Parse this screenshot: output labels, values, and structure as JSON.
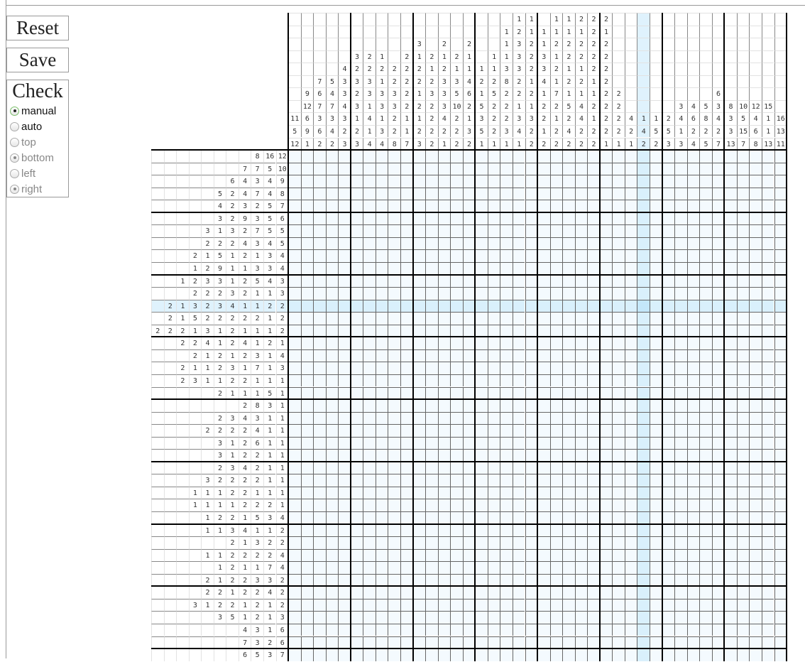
{
  "controls": {
    "reset_label": "Reset",
    "save_label": "Save",
    "check_label": "Check",
    "options": [
      {
        "label": "manual",
        "checked": true,
        "enabled": true
      },
      {
        "label": "auto",
        "checked": false,
        "enabled": true
      },
      {
        "label": "top",
        "checked": false,
        "enabled": false
      },
      {
        "label": "bottom",
        "checked": true,
        "enabled": false
      },
      {
        "label": "left",
        "checked": false,
        "enabled": false
      },
      {
        "label": "right",
        "checked": true,
        "enabled": false
      }
    ]
  },
  "puzzle": {
    "highlight_column": 29,
    "highlight_row": 13,
    "colors": {
      "cell": "#f4fafe",
      "highlight": "#d9f0fc",
      "intersection": "#c4e7fa",
      "grid_line": "#666666",
      "major_line": "#000000"
    },
    "column_clues": [
      [
        11,
        5,
        12
      ],
      [
        9,
        12,
        6,
        9,
        1
      ],
      [
        7,
        6,
        7,
        3,
        6,
        2
      ],
      [
        5,
        4,
        7,
        3,
        4,
        2
      ],
      [
        4,
        3,
        3,
        4,
        3,
        2,
        3
      ],
      [
        3,
        2,
        3,
        2,
        3,
        1,
        2,
        3
      ],
      [
        2,
        2,
        3,
        3,
        1,
        4,
        1,
        4
      ],
      [
        1,
        2,
        1,
        3,
        3,
        1,
        3,
        4
      ],
      [
        2,
        2,
        3,
        3,
        2,
        2,
        8
      ],
      [
        2,
        2,
        2,
        2,
        2,
        1,
        1,
        7
      ],
      [
        3,
        1,
        2,
        2,
        1,
        2,
        1,
        2,
        3
      ],
      [
        2,
        1,
        2,
        3,
        2,
        2,
        2,
        2
      ],
      [
        2,
        1,
        2,
        3,
        3,
        3,
        4,
        2,
        1
      ],
      [
        2,
        1,
        3,
        5,
        10,
        2,
        2,
        2
      ],
      [
        2,
        1,
        1,
        4,
        6,
        2,
        1,
        3,
        2
      ],
      [
        1,
        2,
        1,
        5,
        3,
        5,
        1
      ],
      [
        1,
        1,
        2,
        5,
        2,
        2,
        2,
        1
      ],
      [
        1,
        1,
        1,
        3,
        8,
        2,
        2,
        2,
        3,
        1
      ],
      [
        1,
        2,
        3,
        3,
        3,
        2,
        2,
        1,
        3,
        4,
        1
      ],
      [
        1,
        1,
        2,
        2,
        2,
        1,
        2,
        1,
        3,
        2,
        2
      ],
      [
        1,
        1,
        3,
        3,
        4,
        1,
        2,
        2,
        1,
        2
      ],
      [
        1,
        1,
        2,
        1,
        2,
        1,
        7,
        2,
        1,
        2,
        2
      ],
      [
        1,
        1,
        2,
        2,
        1,
        2,
        1,
        5,
        2,
        4,
        2
      ],
      [
        2,
        1,
        2,
        2,
        1,
        2,
        1,
        4,
        4,
        2,
        2
      ],
      [
        2,
        2,
        2,
        2,
        2,
        1,
        1,
        2,
        1,
        2,
        2
      ],
      [
        2,
        1,
        2,
        2,
        2,
        2,
        2,
        2,
        2,
        2,
        1
      ],
      [
        2,
        2,
        2,
        2,
        1
      ],
      [
        4,
        2,
        1
      ],
      [
        1,
        4,
        2
      ],
      [
        1,
        5,
        2
      ],
      [
        2,
        5,
        3
      ],
      [
        3,
        4,
        1,
        3
      ],
      [
        4,
        6,
        2,
        4
      ],
      [
        5,
        8,
        2,
        5
      ],
      [
        6,
        3,
        4,
        2,
        7
      ],
      [
        8,
        3,
        3,
        13
      ],
      [
        10,
        5,
        15,
        7
      ],
      [
        12,
        4,
        6,
        8
      ],
      [
        15,
        1,
        1,
        13
      ],
      [
        16,
        13,
        11
      ]
    ],
    "row_clues": [
      [
        8,
        16,
        12
      ],
      [
        7,
        7,
        5,
        10
      ],
      [
        6,
        4,
        3,
        4,
        9
      ],
      [
        5,
        2,
        4,
        7,
        4,
        8
      ],
      [
        4,
        2,
        3,
        2,
        5,
        7
      ],
      [
        3,
        2,
        9,
        3,
        5,
        6
      ],
      [
        3,
        1,
        3,
        2,
        7,
        5,
        5
      ],
      [
        2,
        2,
        2,
        4,
        3,
        4,
        5
      ],
      [
        2,
        1,
        5,
        1,
        2,
        1,
        3,
        4
      ],
      [
        1,
        2,
        9,
        1,
        1,
        3,
        3,
        4
      ],
      [
        1,
        2,
        3,
        3,
        1,
        2,
        5,
        4,
        3
      ],
      [
        2,
        2,
        2,
        3,
        2,
        1,
        1,
        3
      ],
      [
        2,
        1,
        3,
        2,
        3,
        4,
        1,
        1,
        2,
        2
      ],
      [
        2,
        1,
        5,
        2,
        2,
        2,
        2,
        2,
        1,
        2
      ],
      [
        2,
        2,
        2,
        1,
        3,
        1,
        2,
        1,
        1,
        1,
        2
      ],
      [
        2,
        2,
        4,
        1,
        2,
        4,
        1,
        2,
        1
      ],
      [
        2,
        1,
        2,
        1,
        2,
        3,
        1,
        4
      ],
      [
        2,
        1,
        1,
        2,
        3,
        1,
        7,
        1,
        3
      ],
      [
        2,
        3,
        1,
        1,
        2,
        2,
        1,
        1,
        1
      ],
      [
        2,
        1,
        1,
        1,
        5,
        1
      ],
      [
        2,
        8,
        3,
        1
      ],
      [
        2,
        3,
        4,
        3,
        1,
        1
      ],
      [
        2,
        2,
        2,
        2,
        4,
        1,
        1
      ],
      [
        3,
        1,
        2,
        6,
        1,
        1
      ],
      [
        3,
        1,
        2,
        2,
        1,
        1
      ],
      [
        2,
        3,
        4,
        2,
        1,
        1
      ],
      [
        3,
        2,
        2,
        2,
        2,
        1,
        1
      ],
      [
        1,
        1,
        1,
        2,
        2,
        1,
        1,
        1
      ],
      [
        1,
        1,
        1,
        1,
        2,
        2,
        2,
        1
      ],
      [
        1,
        2,
        2,
        1,
        5,
        3,
        4
      ],
      [
        1,
        1,
        3,
        4,
        1,
        1,
        2
      ],
      [
        2,
        1,
        3,
        2,
        2
      ],
      [
        1,
        1,
        2,
        2,
        2,
        2,
        4
      ],
      [
        1,
        2,
        1,
        1,
        7,
        4
      ],
      [
        2,
        1,
        2,
        2,
        3,
        3,
        2
      ],
      [
        2,
        2,
        1,
        2,
        2,
        4,
        2
      ],
      [
        3,
        1,
        2,
        2,
        1,
        2,
        1,
        2
      ],
      [
        3,
        5,
        1,
        2,
        1,
        3
      ],
      [
        4,
        3,
        1,
        6
      ],
      [
        7,
        3,
        2,
        6
      ],
      [
        6,
        5,
        3,
        7
      ]
    ]
  }
}
